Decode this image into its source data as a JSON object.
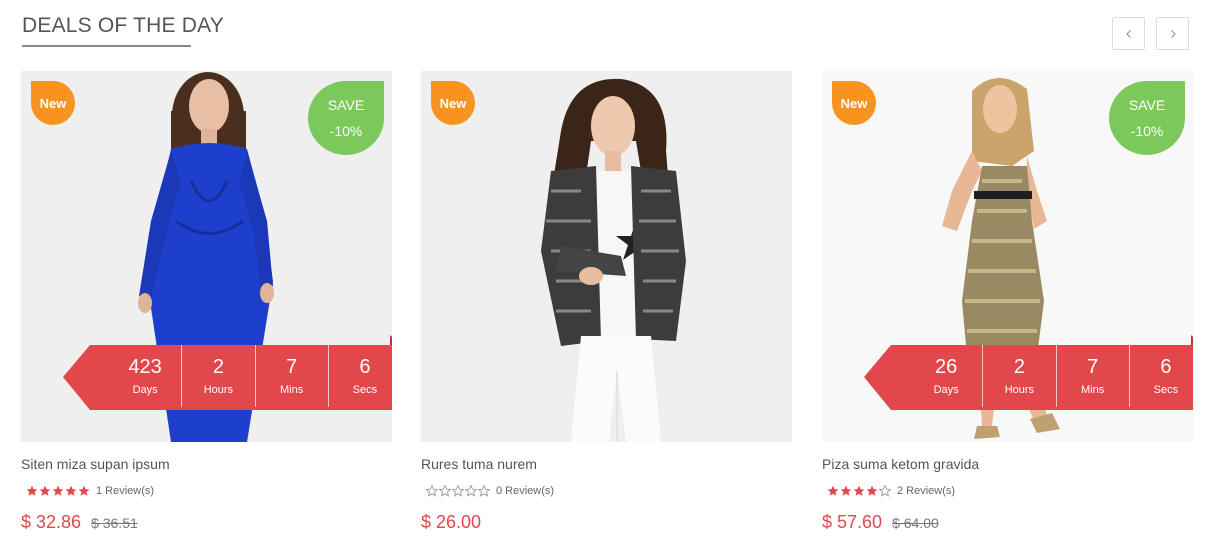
{
  "section": {
    "title": "DEALS OF THE DAY"
  },
  "nav": {
    "prev_icon": "chevron-left-icon",
    "next_icon": "chevron-right-icon"
  },
  "colors": {
    "accent_red": "#e2474b",
    "new_badge": "#f7931e",
    "save_badge": "#7dc85b",
    "star_filled": "#e2474b",
    "star_empty": "#999999"
  },
  "products": [
    {
      "name": "Siten miza supan ipsum",
      "badge_new": "New",
      "badge_save_label": "SAVE",
      "badge_save_value": "-10%",
      "countdown": {
        "days": "423",
        "days_label": "Days",
        "hours": "2",
        "hours_label": "Hours",
        "mins": "7",
        "mins_label": "Mins",
        "secs": "6",
        "secs_label": "Secs"
      },
      "rating": 5,
      "reviews": "1 Review(s)",
      "price": "$ 32.86",
      "old_price": "$ 36.51"
    },
    {
      "name": "Rures tuma nurem",
      "badge_new": "New",
      "rating": 0,
      "reviews": "0 Review(s)",
      "price": "$ 26.00"
    },
    {
      "name": "Piza suma ketom gravida",
      "badge_new": "New",
      "badge_save_label": "SAVE",
      "badge_save_value": "-10%",
      "countdown": {
        "days": "26",
        "days_label": "Days",
        "hours": "2",
        "hours_label": "Hours",
        "mins": "7",
        "mins_label": "Mins",
        "secs": "6",
        "secs_label": "Secs"
      },
      "rating": 4,
      "reviews": "2 Review(s)",
      "price": "$ 57.60",
      "old_price": "$ 64.00"
    }
  ]
}
